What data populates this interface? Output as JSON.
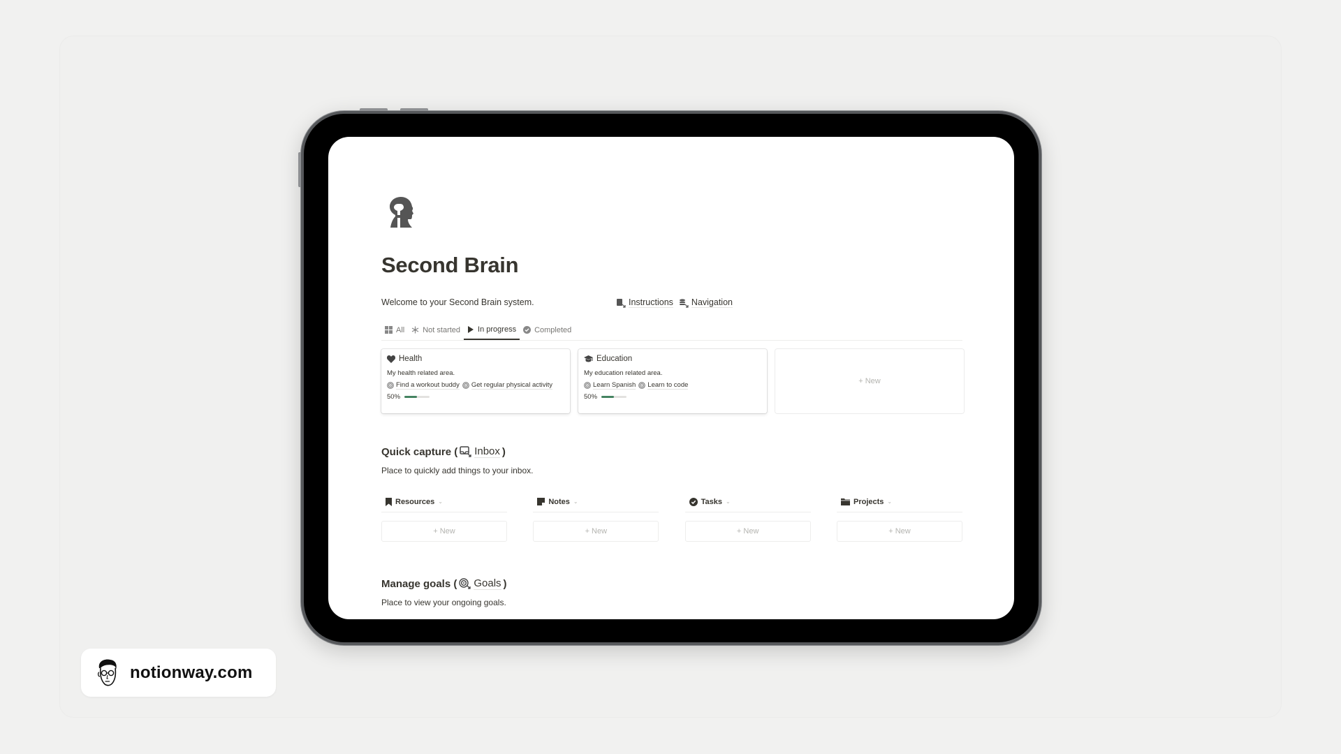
{
  "page": {
    "title": "Second Brain",
    "welcome": "Welcome to your Second Brain system.",
    "links": [
      {
        "label": "Instructions",
        "icon": "book-link-icon"
      },
      {
        "label": "Navigation",
        "icon": "database-link-icon"
      }
    ]
  },
  "tabs": [
    {
      "label": "All",
      "icon": "grid-icon",
      "active": false
    },
    {
      "label": "Not started",
      "icon": "snowflake-icon",
      "active": false
    },
    {
      "label": "In progress",
      "icon": "play-icon",
      "active": true
    },
    {
      "label": "Completed",
      "icon": "check-circle-icon",
      "active": false
    }
  ],
  "areas": [
    {
      "name": "Health",
      "icon": "heart-icon",
      "description": "My health related area.",
      "goals": [
        "Find a workout buddy",
        "Get regular physical activity"
      ],
      "progress_label": "50%",
      "progress": 0.5
    },
    {
      "name": "Education",
      "icon": "graduation-cap-icon",
      "description": "My education related area.",
      "goals": [
        "Learn Spanish",
        "Learn to code"
      ],
      "progress_label": "50%",
      "progress": 0.5
    }
  ],
  "new_label": "+ New",
  "quick_capture": {
    "heading": "Quick capture (",
    "link": "Inbox",
    "close": ")",
    "description": "Place to quickly add things to your inbox.",
    "databases": [
      {
        "label": "Resources",
        "icon": "bookmark-icon"
      },
      {
        "label": "Notes",
        "icon": "note-icon"
      },
      {
        "label": "Tasks",
        "icon": "check-circle-icon"
      },
      {
        "label": "Projects",
        "icon": "folder-icon"
      }
    ]
  },
  "manage_goals": {
    "heading": "Manage goals (",
    "link": "Goals",
    "close": ")",
    "description": "Place to view your ongoing goals."
  },
  "brand": {
    "site": "notionway.com"
  },
  "colors": {
    "progress": "#448361",
    "text": "#37352f"
  }
}
